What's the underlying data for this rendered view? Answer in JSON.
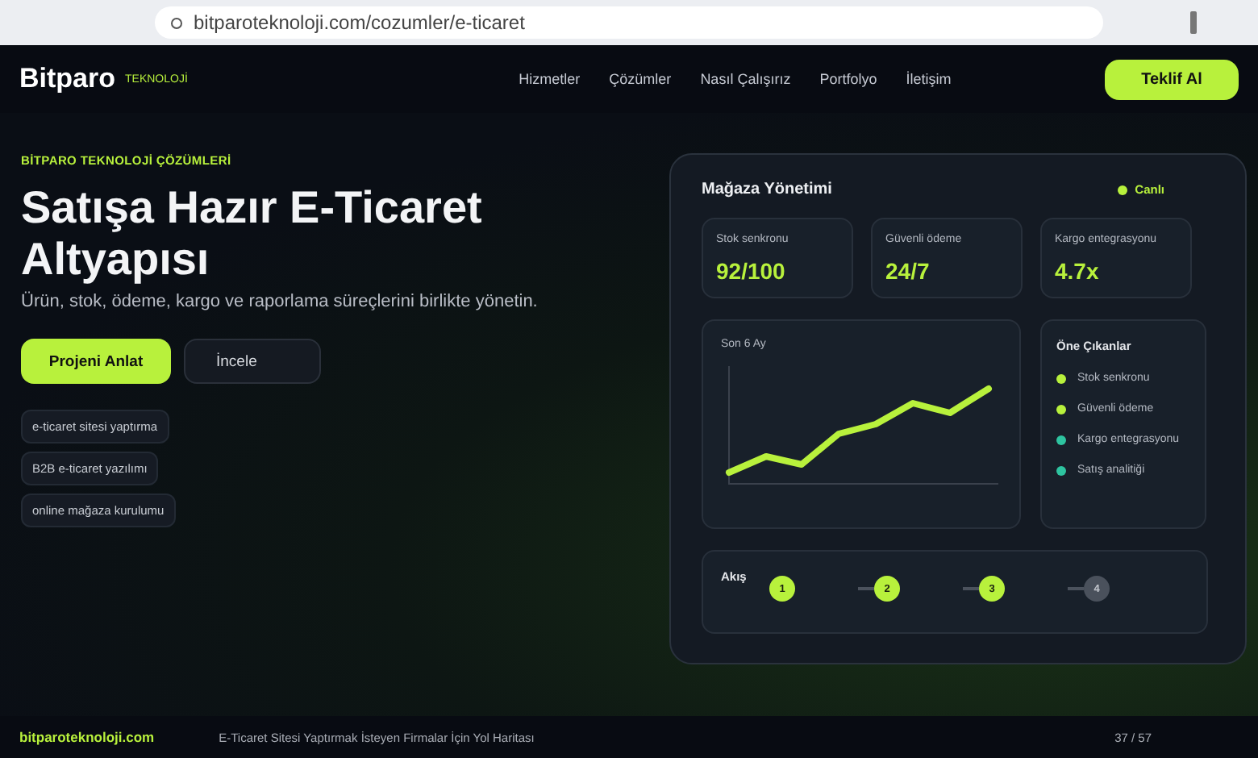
{
  "browser": {
    "url": "bitparoteknoloji.com/cozumler/e-ticaret"
  },
  "nav": {
    "brand": "Bitparo",
    "brand_tag": "TEKNOLOJİ",
    "links": [
      "Hizmetler",
      "Çözümler",
      "Nasıl Çalışırız",
      "Portfolyo",
      "İletişim"
    ],
    "cta": "Teklif Al"
  },
  "hero": {
    "eyebrow": "BİTPARO TEKNOLOJİ ÇÖZÜMLERİ",
    "title": "Satışa Hazır E-Ticaret Altyapısı",
    "subtitle": "Ürün, stok, ödeme, kargo ve raporlama süreçlerini birlikte yönetin.",
    "primary_button": "Projeni Anlat",
    "secondary_button": "İncele",
    "tags": [
      "e-ticaret sitesi yaptırma",
      "B2B e-ticaret yazılımı",
      "online mağaza kurulumu"
    ]
  },
  "dashboard": {
    "title": "Mağaza Yönetimi",
    "status": "Canlı",
    "stats": [
      {
        "label": "Stok senkronu",
        "value": "92/100"
      },
      {
        "label": "Güvenli ödeme",
        "value": "24/7"
      },
      {
        "label": "Kargo entegrasyonu",
        "value": "4.7x"
      }
    ],
    "chart_title": "Son 6 Ay",
    "highlights_title": "Öne Çıkanlar",
    "highlights": [
      {
        "label": "Stok senkronu",
        "color": "#b8f13c"
      },
      {
        "label": "Güvenli ödeme",
        "color": "#b8f13c"
      },
      {
        "label": "Kargo entegrasyonu",
        "color": "#2ec4a0"
      },
      {
        "label": "Satış analitiği",
        "color": "#2ec4a0"
      }
    ],
    "flow_title": "Akış",
    "steps": [
      {
        "label": "1",
        "done": true
      },
      {
        "label": "2",
        "done": true
      },
      {
        "label": "3",
        "done": true
      },
      {
        "label": "4",
        "done": false
      }
    ]
  },
  "footer": {
    "site": "bitparoteknoloji.com",
    "article": "E-Ticaret Sitesi Yaptırmak İsteyen Firmalar İçin Yol Haritası",
    "page": "37 / 57"
  }
}
